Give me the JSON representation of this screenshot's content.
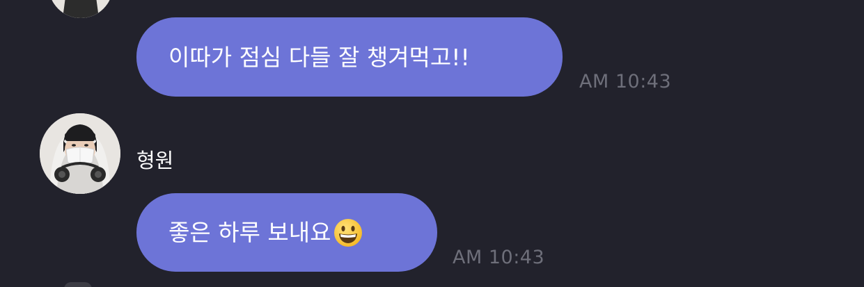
{
  "messages": [
    {
      "text": "이따가 점심 다들 잘 챙겨먹고!!",
      "time": "AM 10:43"
    },
    {
      "sender": "형원",
      "avatar_icon": "profile-photo-masked-person",
      "text": "좋은 하루 보내요",
      "emoji": "grinning-face-icon",
      "time": "AM 10:43"
    }
  ],
  "colors": {
    "background": "#22222c",
    "bubble": "#6d74d7",
    "timestamp": "#6e6f7a",
    "text": "#ffffff"
  }
}
